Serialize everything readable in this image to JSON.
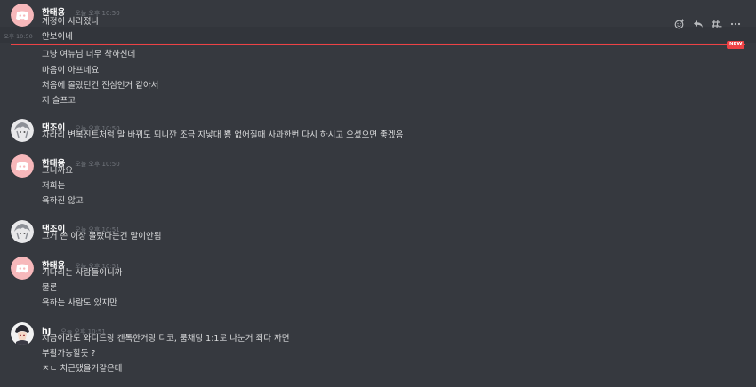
{
  "colors": {
    "background": "#36393f",
    "hover_background": "#32353b",
    "author": "#ffffff",
    "text": "#dcddde",
    "timestamp": "#72767d",
    "new_divider": "#ed4245",
    "discord_avatar_bg": "#f7b8bb"
  },
  "toolbar": {
    "icons": [
      "add-reaction-icon",
      "reply-icon",
      "create-thread-icon",
      "more-icon"
    ]
  },
  "new_badge": "NEW",
  "groups": [
    {
      "author": "한태용",
      "timestamp": "오늘 오후 10:50",
      "avatar": "discord-default-avatar",
      "lines": [
        {
          "text": "계정이 사라졌나"
        },
        {
          "text": "안보이네",
          "side_ts": "오후 10:50"
        },
        {
          "text": "그냥 여뉴님 너무 착하신데"
        },
        {
          "text": "마음이 아프네요"
        },
        {
          "text": "처음에 몰랐던건 진심인거 같아서"
        },
        {
          "text": "저 슬프고"
        }
      ]
    },
    {
      "author": "댄조이",
      "timestamp": "오늘 오후 10:50",
      "avatar": "anime-avatar",
      "lines": [
        {
          "text": "차라리 변복진트처럼 말 바꿔도 되니깐 조금 자낳대 뿅 없어질때 사과한번 다시 하시고 오셨으면 좋겠음"
        }
      ]
    },
    {
      "author": "한태용",
      "timestamp": "오늘 오후 10:50",
      "avatar": "discord-default-avatar",
      "lines": [
        {
          "text": "그니까요"
        },
        {
          "text": "저희는"
        },
        {
          "text": "욕하진 않고"
        }
      ]
    },
    {
      "author": "댄조이",
      "timestamp": "오늘 오후 10:51",
      "avatar": "anime-avatar",
      "lines": [
        {
          "text": "그거 쓴 이상 몰랐다는건 말이안됨"
        }
      ]
    },
    {
      "author": "한태용",
      "timestamp": "오늘 오후 10:51",
      "avatar": "discord-default-avatar",
      "lines": [
        {
          "text": "기다리는 사람들이니까"
        },
        {
          "text": "물론"
        },
        {
          "text": "욕하는 사람도 있지만"
        }
      ]
    },
    {
      "author": "hJ",
      "timestamp": "오늘 오후 10:51",
      "avatar": "character-avatar",
      "lines": [
        {
          "text": "지금이라도 와디드랑 갠톡한거랑 디코, 룸채팅 1:1로 나눈거 죄다 까면"
        },
        {
          "text": "부활가능할듯 ?"
        },
        {
          "text": "ㅈㄴ 치근댔을거같은데"
        }
      ]
    }
  ]
}
